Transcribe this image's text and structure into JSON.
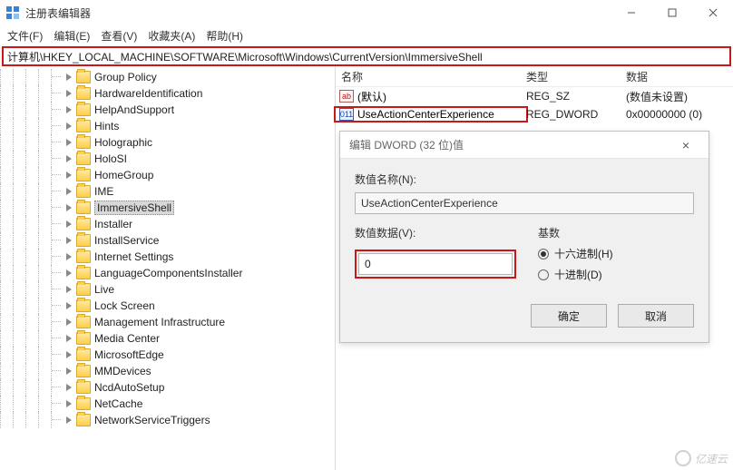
{
  "window": {
    "title": "注册表编辑器",
    "menu": {
      "file": "文件(F)",
      "edit": "编辑(E)",
      "view": "查看(V)",
      "favorites": "收藏夹(A)",
      "help": "帮助(H)"
    },
    "address": "计算机\\HKEY_LOCAL_MACHINE\\SOFTWARE\\Microsoft\\Windows\\CurrentVersion\\ImmersiveShell"
  },
  "tree": {
    "items": [
      "Group Policy",
      "HardwareIdentification",
      "HelpAndSupport",
      "Hints",
      "Holographic",
      "HoloSI",
      "HomeGroup",
      "IME",
      "ImmersiveShell",
      "Installer",
      "InstallService",
      "Internet Settings",
      "LanguageComponentsInstaller",
      "Live",
      "Lock Screen",
      "Management Infrastructure",
      "Media Center",
      "MicrosoftEdge",
      "MMDevices",
      "NcdAutoSetup",
      "NetCache",
      "NetworkServiceTriggers"
    ],
    "selectedIndex": 8
  },
  "list": {
    "headers": {
      "name": "名称",
      "type": "类型",
      "data": "数据"
    },
    "rows": [
      {
        "iconType": "str",
        "name": "(默认)",
        "type": "REG_SZ",
        "data": "(数值未设置)"
      },
      {
        "iconType": "bin",
        "name": "UseActionCenterExperience",
        "type": "REG_DWORD",
        "data": "0x00000000 (0)"
      }
    ],
    "highlightIndex": 1
  },
  "dialog": {
    "title": "编辑 DWORD (32 位)值",
    "nameLabel": "数值名称(N):",
    "nameValue": "UseActionCenterExperience",
    "valueLabel": "数值数据(V):",
    "valueData": "0",
    "radixLabel": "基数",
    "hexLabel": "十六进制(H)",
    "decLabel": "十进制(D)",
    "ok": "确定",
    "cancel": "取消"
  },
  "watermark": "亿速云"
}
